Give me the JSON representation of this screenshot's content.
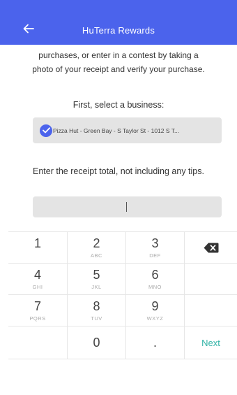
{
  "appbar": {
    "title": "HuTerra Rewards",
    "color": "#4b63ec"
  },
  "intro": {
    "line1": "purchases, or enter in a contest by taking a",
    "line2": "photo of your receipt and verify your purchase."
  },
  "business": {
    "label": "First, select a business:",
    "selected": "Pizza Hut - Green Bay - S Taylor St - 1012 S T..."
  },
  "receipt_total": {
    "label": "Enter the receipt total, not including any tips.",
    "value": "",
    "placeholder": ""
  },
  "keypad": {
    "accent": "#31b3a6",
    "keys": {
      "k1": {
        "digit": "1",
        "letters": ""
      },
      "k2": {
        "digit": "2",
        "letters": "ABC"
      },
      "k3": {
        "digit": "3",
        "letters": "DEF"
      },
      "k4": {
        "digit": "4",
        "letters": "GHI"
      },
      "k5": {
        "digit": "5",
        "letters": "JKL"
      },
      "k6": {
        "digit": "6",
        "letters": "MNO"
      },
      "k7": {
        "digit": "7",
        "letters": "PQRS"
      },
      "k8": {
        "digit": "8",
        "letters": "TUV"
      },
      "k9": {
        "digit": "9",
        "letters": "WXYZ"
      },
      "k0": {
        "digit": "0",
        "letters": ""
      }
    },
    "dot": ".",
    "next_label": "Next",
    "backspace_icon": "backspace-icon"
  }
}
